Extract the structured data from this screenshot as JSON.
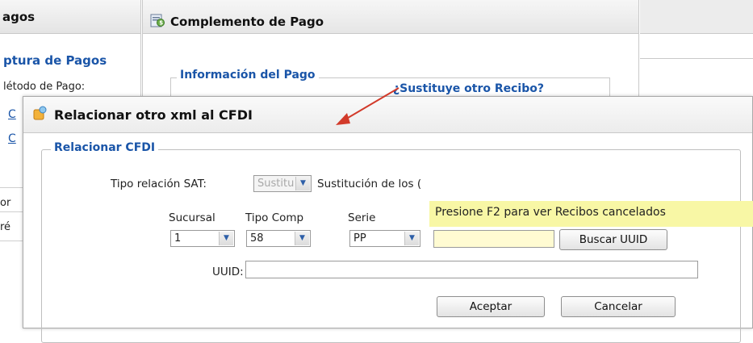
{
  "background_left": {
    "header": "agos",
    "section_title": "ptura de Pagos",
    "metodo_label": "létodo de Pago:",
    "link1": "C",
    "link2": "C",
    "row_text1": "or",
    "row_text2": "ré"
  },
  "complemento": {
    "title": "Complemento de Pago",
    "legend": "Información del Pago",
    "sustituye_link": "¿Sustituye otro Recibo?"
  },
  "dialog": {
    "title": "Relacionar otro xml al CFDI",
    "legend": "Relacionar CFDI",
    "tipo_relacion_label": "Tipo relación SAT:",
    "tipo_relacion_value": "Sustitu",
    "tipo_relacion_desc": "Sustitución de los (",
    "sucursal_label": "Sucursal",
    "sucursal_value": "1",
    "tipo_comp_label": "Tipo Comp",
    "tipo_comp_value": "58",
    "serie_label": "Serie",
    "serie_value": "PP",
    "tooltip": "Presione F2 para  ver Recibos cancelados",
    "buscar_button": "Buscar UUID",
    "uuid_label": "UUID:",
    "uuid_value": "",
    "aceptar_button": "Aceptar",
    "cancelar_button": "Cancelar"
  },
  "colors": {
    "accent_blue": "#1a55a8",
    "tooltip_yellow": "#f8f7a5",
    "annotation_red": "#d23a2a"
  }
}
